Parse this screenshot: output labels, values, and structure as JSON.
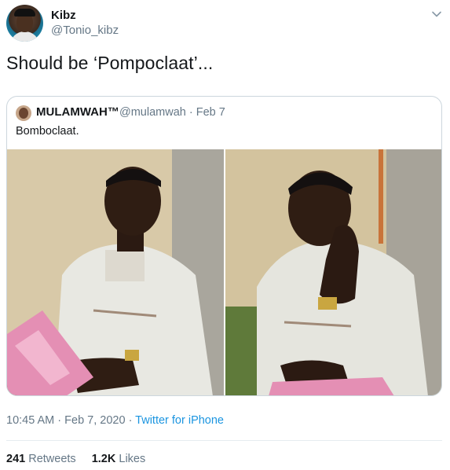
{
  "author": {
    "name": "Kibz",
    "handle": "@Tonio_kibz"
  },
  "tweet": {
    "text": "Should be ‘Pompoclaat’..."
  },
  "quoted": {
    "name": "MULAMWAH™",
    "meta": "@mulamwah · Feb 7",
    "text": "Bomboclaat."
  },
  "footer": {
    "time": "10:45 AM · Feb 7, 2020 · ",
    "source": "Twitter for iPhone",
    "retweets_count": "241",
    "retweets_label": " Retweets",
    "likes_count": "1.2K",
    "likes_label": " Likes"
  },
  "colors": {
    "link": "#1b95e0",
    "secondary_text": "#657786",
    "border": "#ccd6dd"
  },
  "icons": {
    "menu": "chevron-down-icon"
  }
}
